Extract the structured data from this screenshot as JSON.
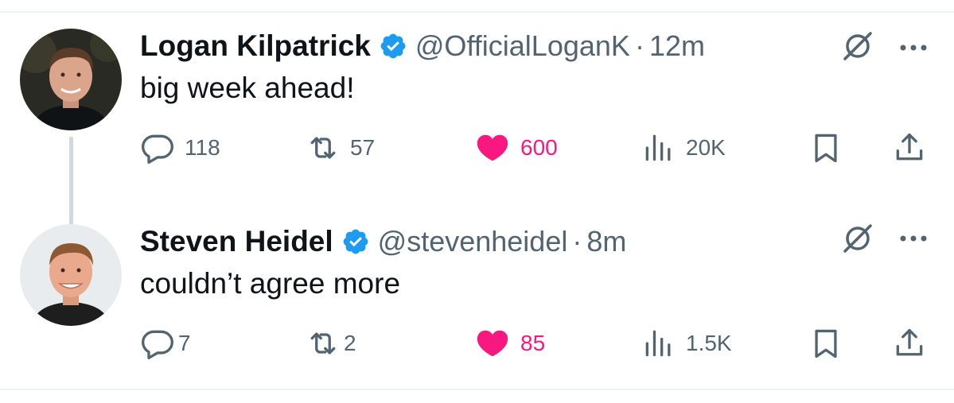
{
  "tweets": [
    {
      "author_name": "Logan Kilpatrick",
      "handle": "@OfficialLoganK",
      "separator": "·",
      "time": "12m",
      "text": "big week ahead!",
      "replies": "118",
      "reposts": "57",
      "likes": "600",
      "views": "20K"
    },
    {
      "author_name": "Steven Heidel",
      "handle": "@stevenheidel",
      "separator": "·",
      "time": "8m",
      "text": "couldn’t agree more",
      "replies": "7",
      "reposts": "2",
      "likes": "85",
      "views": "1.5K"
    }
  ],
  "colors": {
    "verified_blue": "#1d9bf0",
    "like_pink": "#f91880",
    "secondary_text": "#536471",
    "primary_text": "#0f1419",
    "thread_line": "#cfd9de"
  },
  "icons": [
    "verified-badge-icon",
    "grok-icon",
    "more-icon",
    "reply-icon",
    "repost-icon",
    "like-icon",
    "views-icon",
    "bookmark-icon",
    "share-icon"
  ]
}
